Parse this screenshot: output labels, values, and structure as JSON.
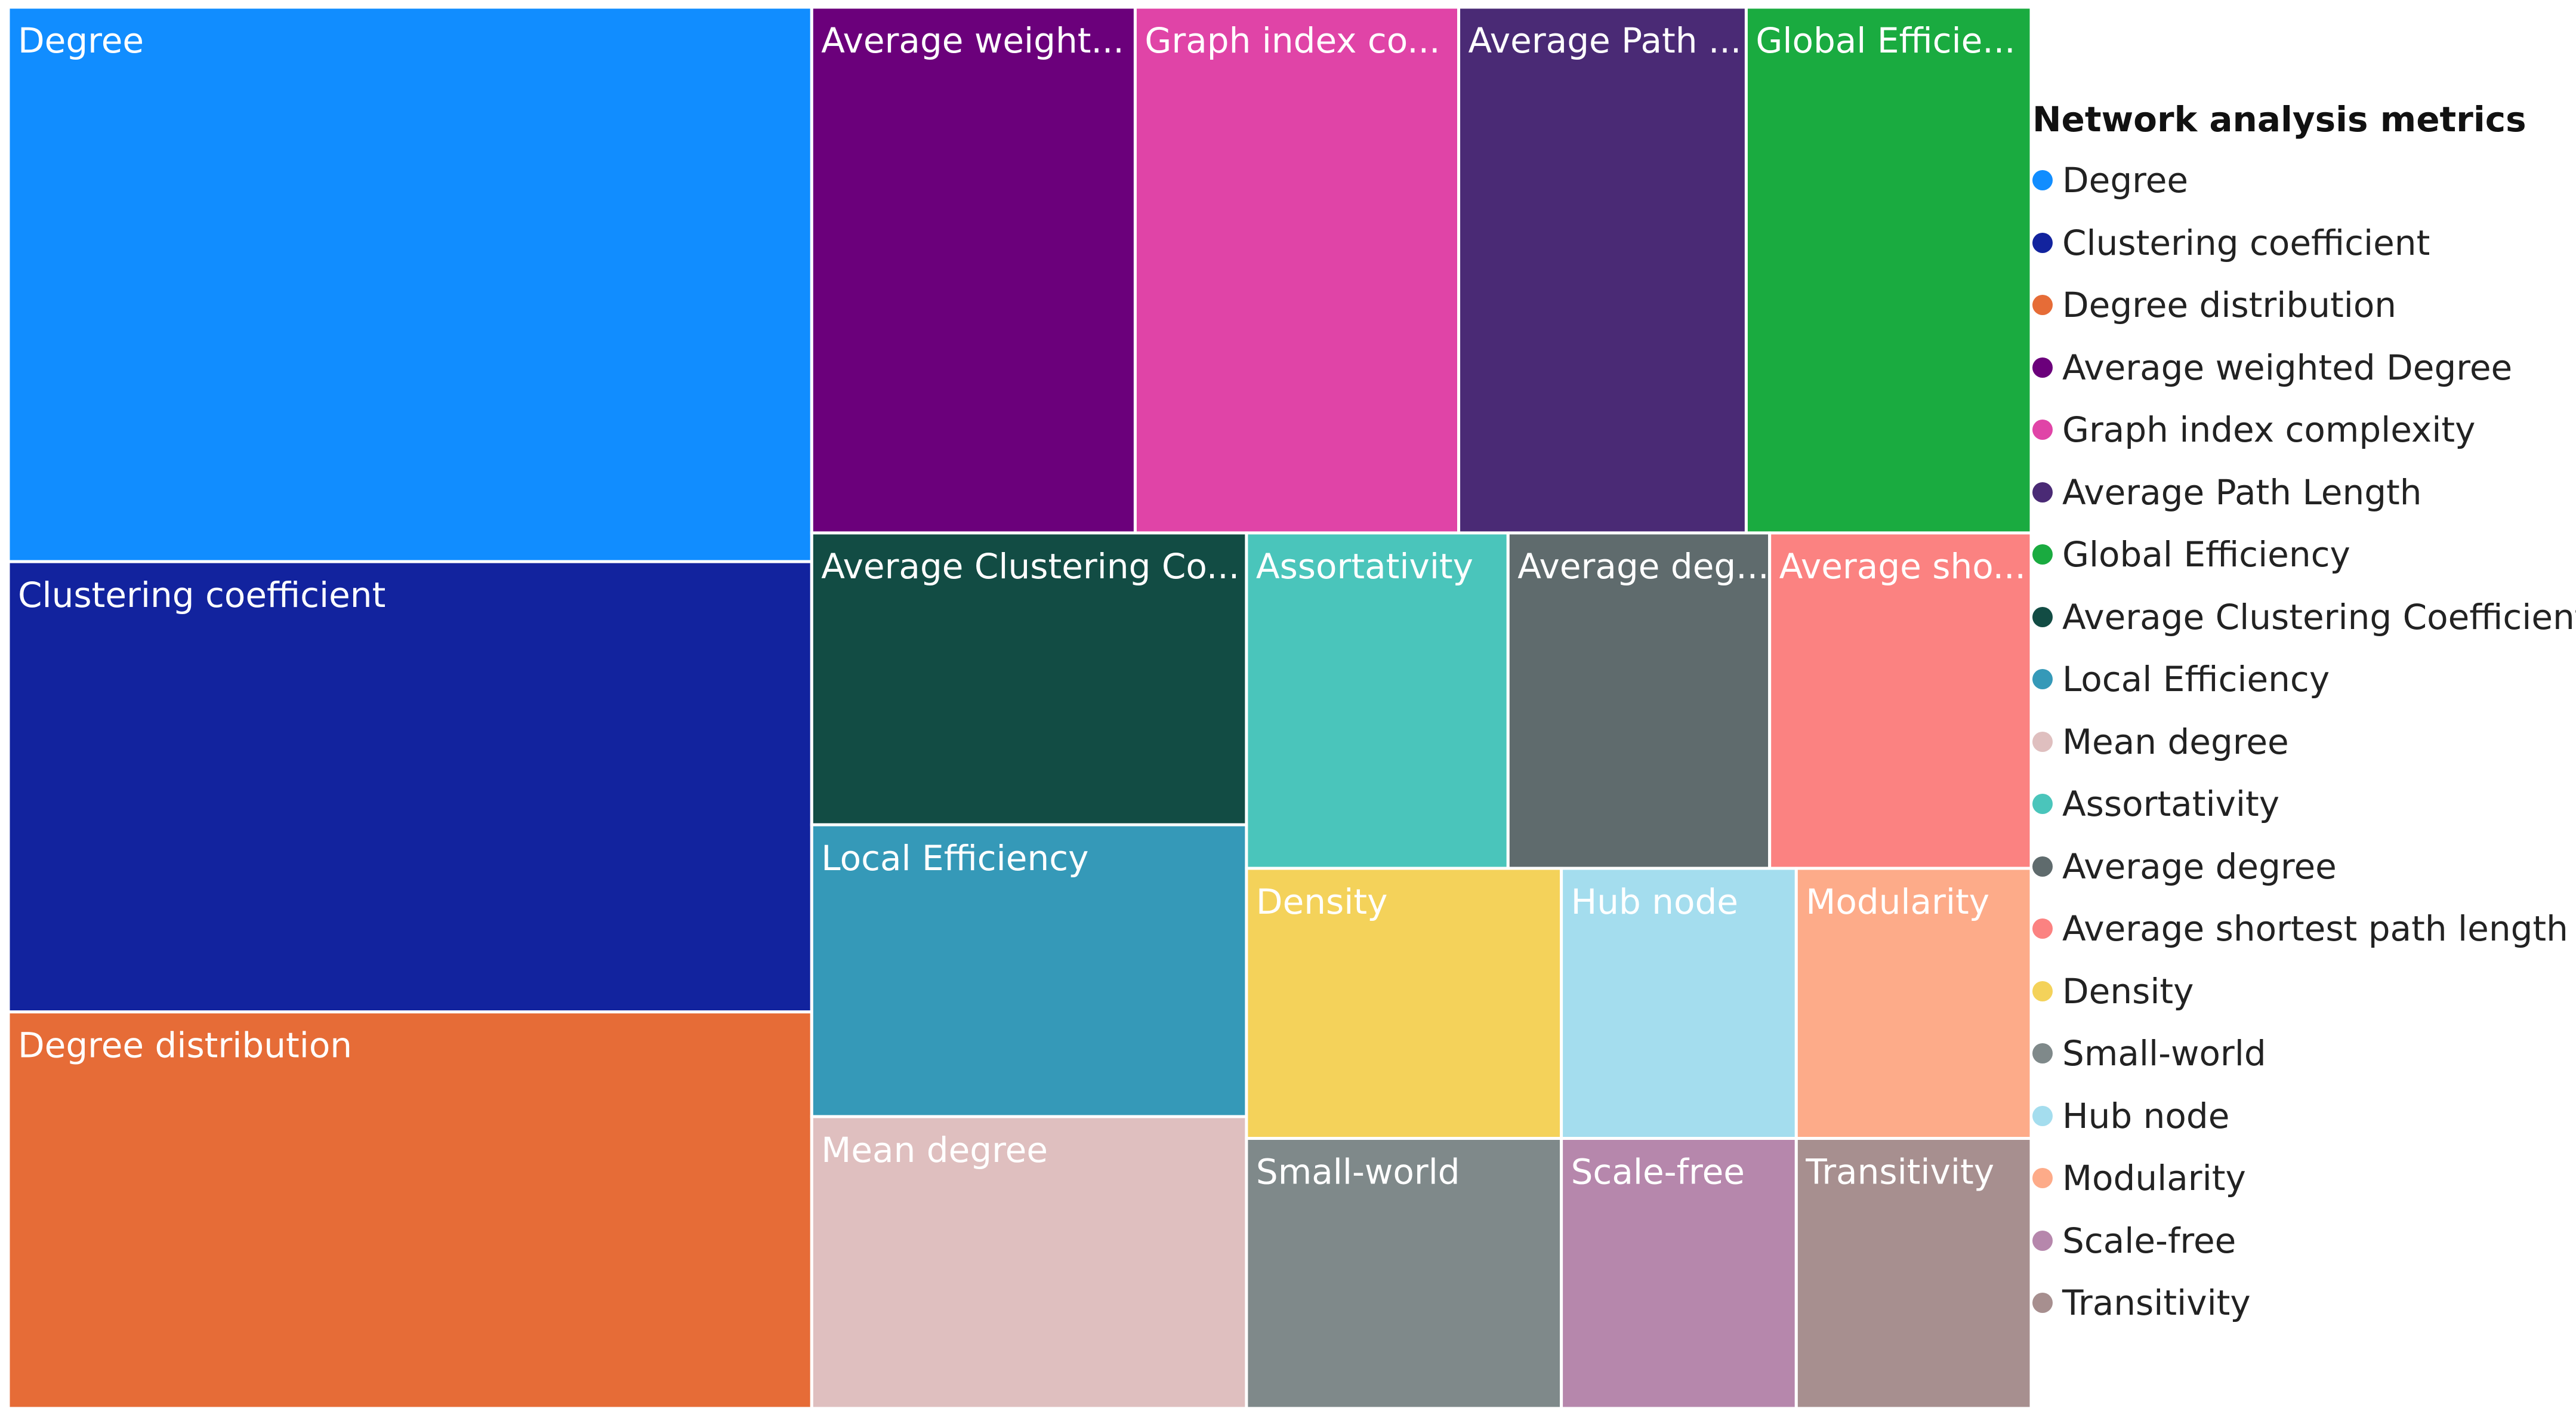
{
  "chart_data": {
    "type": "treemap",
    "legend_title": "Network analysis metrics",
    "legend_position": "right",
    "items": [
      {
        "name": "Degree",
        "label": "Degree",
        "value": 1650,
        "color": "#118DFF"
      },
      {
        "name": "Clustering coefficient",
        "label": "Clustering coefficient",
        "value": 1340,
        "color": "#12239E"
      },
      {
        "name": "Degree distribution",
        "label": "Degree distribution",
        "value": 1180,
        "color": "#E66C37"
      },
      {
        "name": "Average weighted Degree",
        "label": "Average weight...",
        "value": 630,
        "color": "#6B007B"
      },
      {
        "name": "Graph index complexity",
        "label": "Graph index co...",
        "value": 630,
        "color": "#E044A7"
      },
      {
        "name": "Average Path Length",
        "label": "Average Path ...",
        "value": 560,
        "color": "#4A2A75"
      },
      {
        "name": "Global Efficiency",
        "label": "Global Efficie...",
        "value": 555,
        "color": "#1AAB40"
      },
      {
        "name": "Average Clustering Coefficient",
        "label": "Average Clustering Co...",
        "value": 470,
        "color": "#124C44"
      },
      {
        "name": "Local Efficiency",
        "label": "Local Efficiency",
        "value": 470,
        "color": "#3599B8"
      },
      {
        "name": "Mean degree",
        "label": "Mean degree",
        "value": 470,
        "color": "#DFBFBF"
      },
      {
        "name": "Assortativity",
        "label": "Assortativity",
        "value": 325,
        "color": "#4AC5BB"
      },
      {
        "name": "Average degree",
        "label": "Average deg...",
        "value": 325,
        "color": "#5F6B6D"
      },
      {
        "name": "Average shortest path length",
        "label": "Average sho...",
        "value": 325,
        "color": "#FB8281"
      },
      {
        "name": "Density",
        "label": "Density",
        "value": 315,
        "color": "#F4D25A"
      },
      {
        "name": "Small-world",
        "label": "Small-world",
        "value": 315,
        "color": "#7F898A"
      },
      {
        "name": "Hub node",
        "label": "Hub node",
        "value": 235,
        "color": "#A4DDEE"
      },
      {
        "name": "Modularity",
        "label": "Modularity",
        "value": 235,
        "color": "#FDAB89"
      },
      {
        "name": "Scale-free",
        "label": "Scale-free",
        "value": 235,
        "color": "#B687AC"
      },
      {
        "name": "Transitivity",
        "label": "Transitivity",
        "value": 235,
        "color": "#A78F8F"
      }
    ]
  }
}
